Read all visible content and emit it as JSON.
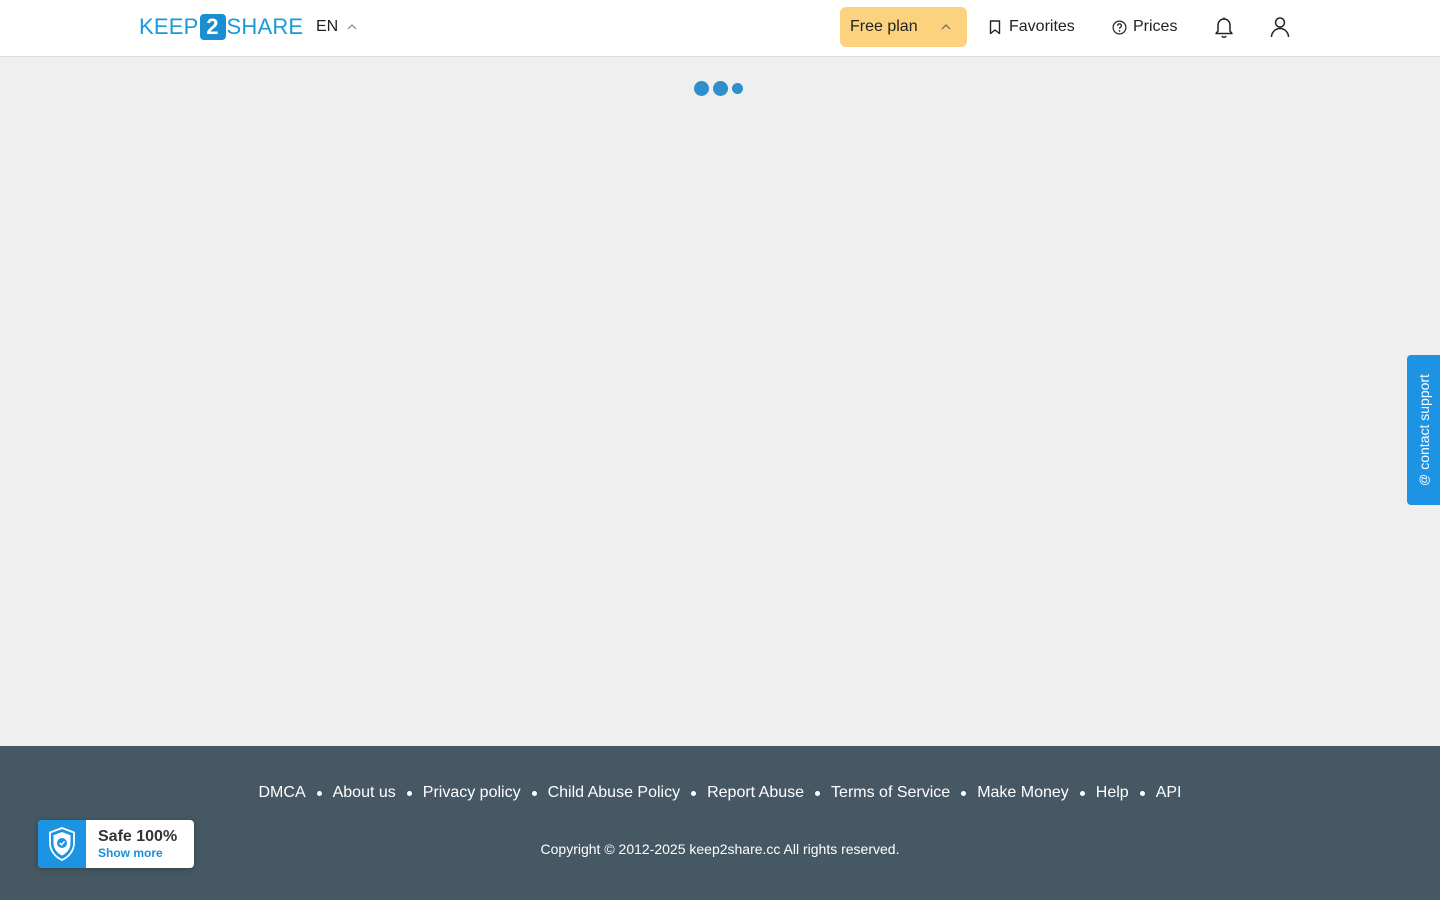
{
  "header": {
    "logo": {
      "left": "KEEP",
      "middle": "2",
      "right": "SHARE"
    },
    "language": "EN",
    "plan_label": "Free plan",
    "favorites_label": "Favorites",
    "prices_label": "Prices"
  },
  "support": {
    "label": "contact support",
    "at_symbol": "@"
  },
  "footer": {
    "links": [
      "DMCA",
      "About us",
      "Privacy policy",
      "Child Abuse Policy",
      "Report Abuse",
      "Terms of Service",
      "Make Money",
      "Help",
      "API"
    ],
    "copyright": "Copyright © 2012-2025 keep2share.cc All rights reserved."
  },
  "safe_badge": {
    "title": "Safe 100%",
    "link": "Show more"
  },
  "colors": {
    "brand_blue": "#1a9ad6",
    "plan_yellow": "#fcd27f",
    "footer_bg": "#465863",
    "support_blue": "#1d94e3"
  }
}
